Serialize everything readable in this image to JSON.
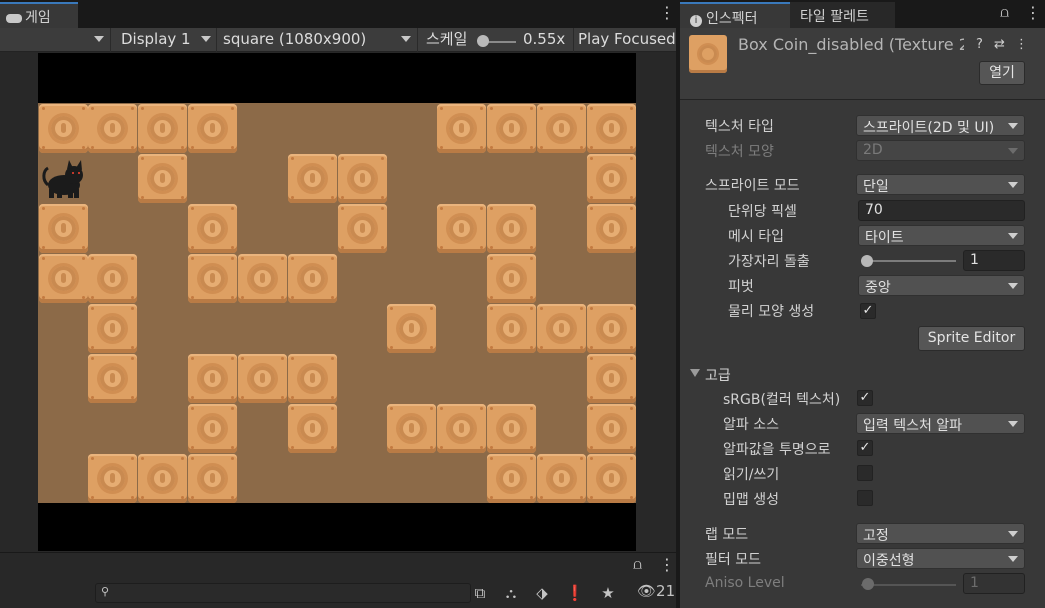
{
  "game": {
    "tab_label": "게임",
    "display": "Display 1",
    "aspect": "square (1080x900)",
    "scale_label": "스케일",
    "scale_value": "0.55x",
    "play_mode": "Play Focused"
  },
  "bottom": {
    "search_placeholder": "",
    "hidden_count": "21"
  },
  "inspector": {
    "tab_inspector": "인스펙터",
    "tab_palette": "타일 팔레트",
    "asset_name": "Box Coin_disabled (Texture 2D)",
    "open_button": "열기",
    "texture_type_label": "텍스처 타입",
    "texture_type_value": "스프라이트(2D 및 UI)",
    "texture_shape_label": "텍스처 모양",
    "texture_shape_value": "2D",
    "sprite_mode_label": "스프라이트 모드",
    "sprite_mode_value": "단일",
    "ppu_label": "단위당 픽셀",
    "ppu_value": "70",
    "mesh_type_label": "메시 타입",
    "mesh_type_value": "타이트",
    "extrude_label": "가장자리 돌출",
    "extrude_value": "1",
    "pivot_label": "피벗",
    "pivot_value": "중앙",
    "physics_shape_label": "물리 모양 생성",
    "physics_shape_checked": true,
    "sprite_editor_button": "Sprite Editor",
    "advanced_label": "고급",
    "srgb_label": "sRGB(컬러 텍스처)",
    "srgb_checked": true,
    "alpha_source_label": "알파 소스",
    "alpha_source_value": "입력 텍스처 알파",
    "alpha_transparency_label": "알파값을 투명으로",
    "alpha_transparency_checked": true,
    "read_write_label": "읽기/쓰기",
    "read_write_checked": false,
    "mipmap_label": "밉맵 생성",
    "mipmap_checked": false,
    "wrap_mode_label": "랩 모드",
    "wrap_mode_value": "고정",
    "filter_mode_label": "필터 모드",
    "filter_mode_value": "이중선형",
    "aniso_label": "Aniso Level",
    "aniso_value": "1"
  },
  "level": {
    "cols": 12,
    "rows": 8,
    "solid_cells": [
      [
        0,
        0
      ],
      [
        1,
        0
      ],
      [
        2,
        0
      ],
      [
        3,
        0
      ],
      [
        8,
        0
      ],
      [
        9,
        0
      ],
      [
        10,
        0
      ],
      [
        11,
        0
      ],
      [
        2,
        1
      ],
      [
        5,
        1
      ],
      [
        6,
        1
      ],
      [
        11,
        1
      ],
      [
        0,
        2
      ],
      [
        3,
        2
      ],
      [
        6,
        2
      ],
      [
        8,
        2
      ],
      [
        9,
        2
      ],
      [
        11,
        2
      ],
      [
        0,
        3
      ],
      [
        1,
        3
      ],
      [
        3,
        3
      ],
      [
        4,
        3
      ],
      [
        5,
        3
      ],
      [
        9,
        3
      ],
      [
        1,
        4
      ],
      [
        7,
        4
      ],
      [
        9,
        4
      ],
      [
        10,
        4
      ],
      [
        11,
        4
      ],
      [
        1,
        5
      ],
      [
        3,
        5
      ],
      [
        4,
        5
      ],
      [
        5,
        5
      ],
      [
        11,
        5
      ],
      [
        3,
        6
      ],
      [
        5,
        6
      ],
      [
        7,
        6
      ],
      [
        8,
        6
      ],
      [
        9,
        6
      ],
      [
        11,
        6
      ],
      [
        1,
        7
      ],
      [
        2,
        7
      ],
      [
        3,
        7
      ],
      [
        9,
        7
      ],
      [
        10,
        7
      ],
      [
        11,
        7
      ]
    ],
    "player_cell": [
      0,
      1
    ]
  },
  "colors": {
    "accent": "#3a79bb",
    "block": "#dea063",
    "background_dirt": "#8c6a48"
  }
}
